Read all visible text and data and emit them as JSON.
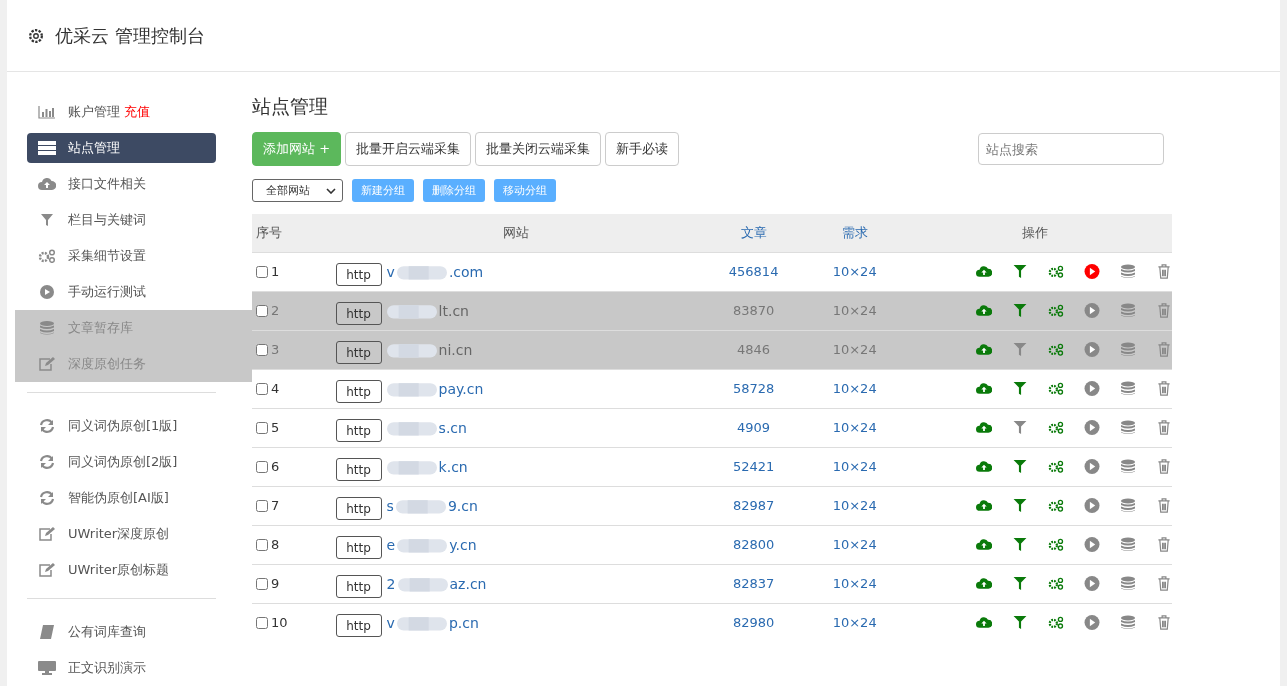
{
  "header": {
    "title": "优采云 管理控制台"
  },
  "sidebar": {
    "groups": [
      {
        "items": [
          {
            "label": "账户管理",
            "badge": "充值",
            "kind": "bar-chart",
            "selected": false,
            "dimmed": false
          },
          {
            "label": "站点管理",
            "kind": "server",
            "selected": true,
            "dimmed": false
          },
          {
            "label": "接口文件相关",
            "kind": "cloud",
            "selected": false,
            "dimmed": false
          },
          {
            "label": "栏目与关键词",
            "kind": "filter",
            "selected": false,
            "dimmed": false
          },
          {
            "label": "采集细节设置",
            "kind": "gears",
            "selected": false,
            "dimmed": false
          },
          {
            "label": "手动运行测试",
            "kind": "play",
            "selected": false,
            "dimmed": false
          },
          {
            "label": "文章暂存库",
            "kind": "database",
            "selected": false,
            "dimmed": true
          },
          {
            "label": "深度原创任务",
            "kind": "edit",
            "selected": false,
            "dimmed": true
          }
        ]
      },
      {
        "items": [
          {
            "label": "同义词伪原创[1版]",
            "kind": "refresh",
            "selected": false,
            "dimmed": false
          },
          {
            "label": "同义词伪原创[2版]",
            "kind": "refresh",
            "selected": false,
            "dimmed": false
          },
          {
            "label": "智能伪原创[AI版]",
            "kind": "refresh",
            "selected": false,
            "dimmed": false
          },
          {
            "label": "UWriter深度原创",
            "kind": "edit",
            "selected": false,
            "dimmed": false
          },
          {
            "label": "UWriter原创标题",
            "kind": "edit",
            "selected": false,
            "dimmed": false
          }
        ]
      },
      {
        "items": [
          {
            "label": "公有词库查询",
            "kind": "book",
            "selected": false,
            "dimmed": false
          },
          {
            "label": "正文识别演示",
            "kind": "monitor",
            "selected": false,
            "dimmed": false
          }
        ]
      }
    ]
  },
  "main": {
    "title": "站点管理",
    "toolbar": [
      {
        "label": "添加网站 +",
        "kind": "primary"
      },
      {
        "label": "批量开启云端采集",
        "kind": "default"
      },
      {
        "label": "批量关闭云端采集",
        "kind": "default"
      },
      {
        "label": "新手必读",
        "kind": "default"
      }
    ],
    "search": {
      "placeholder": "站点搜索"
    },
    "group_select": {
      "value": "全部网站"
    },
    "group_buttons": [
      "新建分组",
      "删除分组",
      "移动分组"
    ],
    "table": {
      "columns": [
        "序号",
        "网站",
        "文章",
        "需求",
        "操作"
      ],
      "rows": [
        {
          "index": "1",
          "checked": false,
          "scheme": "http",
          "domain_start": "v",
          "domain_end": ".com",
          "articles": "456814",
          "demand": "10×24",
          "filter_on": true,
          "running": true,
          "dimmed": false
        },
        {
          "index": "2",
          "checked": false,
          "scheme": "http",
          "domain_end": "lt.cn",
          "articles": "83870",
          "demand": "10×24",
          "filter_on": true,
          "running": false,
          "dimmed": true
        },
        {
          "index": "3",
          "checked": false,
          "scheme": "http",
          "domain_end": "ni.cn",
          "articles": "4846",
          "demand": "10×24",
          "filter_on": false,
          "running": false,
          "dimmed": true
        },
        {
          "index": "4",
          "checked": false,
          "scheme": "http",
          "domain_end": "pay.cn",
          "articles": "58728",
          "demand": "10×24",
          "filter_on": true,
          "running": false,
          "dimmed": false
        },
        {
          "index": "5",
          "checked": false,
          "scheme": "http",
          "domain_end": "s.cn",
          "articles": "4909",
          "demand": "10×24",
          "filter_on": false,
          "running": false,
          "dimmed": false
        },
        {
          "index": "6",
          "checked": false,
          "scheme": "http",
          "domain_end": "k.cn",
          "articles": "52421",
          "demand": "10×24",
          "filter_on": true,
          "running": false,
          "dimmed": false
        },
        {
          "index": "7",
          "checked": false,
          "scheme": "http",
          "domain_start": "s",
          "domain_end": "9.cn",
          "articles": "82987",
          "demand": "10×24",
          "filter_on": true,
          "running": false,
          "dimmed": false
        },
        {
          "index": "8",
          "checked": false,
          "scheme": "http",
          "domain_start": "e",
          "domain_end": "y.cn",
          "articles": "82800",
          "demand": "10×24",
          "filter_on": true,
          "running": false,
          "dimmed": false
        },
        {
          "index": "9",
          "checked": false,
          "scheme": "http",
          "domain_start": "2",
          "domain_end": "az.cn",
          "articles": "82837",
          "demand": "10×24",
          "filter_on": true,
          "running": false,
          "dimmed": false
        },
        {
          "index": "10",
          "checked": false,
          "scheme": "http",
          "domain_start": "v",
          "domain_end": "p.cn",
          "articles": "82980",
          "demand": "10×24",
          "filter_on": true,
          "running": false,
          "dimmed": false
        }
      ]
    }
  }
}
